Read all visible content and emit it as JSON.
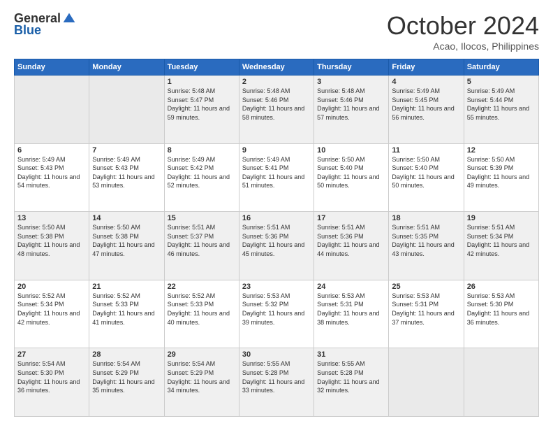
{
  "logo": {
    "general": "General",
    "blue": "Blue"
  },
  "title": "October 2024",
  "location": "Acao, Ilocos, Philippines",
  "days_header": [
    "Sunday",
    "Monday",
    "Tuesday",
    "Wednesday",
    "Thursday",
    "Friday",
    "Saturday"
  ],
  "weeks": [
    [
      {
        "day": "",
        "empty": true
      },
      {
        "day": "",
        "empty": true
      },
      {
        "day": "1",
        "sunrise": "5:48 AM",
        "sunset": "5:47 PM",
        "daylight": "11 hours and 59 minutes."
      },
      {
        "day": "2",
        "sunrise": "5:48 AM",
        "sunset": "5:46 PM",
        "daylight": "11 hours and 58 minutes."
      },
      {
        "day": "3",
        "sunrise": "5:48 AM",
        "sunset": "5:46 PM",
        "daylight": "11 hours and 57 minutes."
      },
      {
        "day": "4",
        "sunrise": "5:49 AM",
        "sunset": "5:45 PM",
        "daylight": "11 hours and 56 minutes."
      },
      {
        "day": "5",
        "sunrise": "5:49 AM",
        "sunset": "5:44 PM",
        "daylight": "11 hours and 55 minutes."
      }
    ],
    [
      {
        "day": "6",
        "sunrise": "5:49 AM",
        "sunset": "5:43 PM",
        "daylight": "11 hours and 54 minutes."
      },
      {
        "day": "7",
        "sunrise": "5:49 AM",
        "sunset": "5:43 PM",
        "daylight": "11 hours and 53 minutes."
      },
      {
        "day": "8",
        "sunrise": "5:49 AM",
        "sunset": "5:42 PM",
        "daylight": "11 hours and 52 minutes."
      },
      {
        "day": "9",
        "sunrise": "5:49 AM",
        "sunset": "5:41 PM",
        "daylight": "11 hours and 51 minutes."
      },
      {
        "day": "10",
        "sunrise": "5:50 AM",
        "sunset": "5:40 PM",
        "daylight": "11 hours and 50 minutes."
      },
      {
        "day": "11",
        "sunrise": "5:50 AM",
        "sunset": "5:40 PM",
        "daylight": "11 hours and 50 minutes."
      },
      {
        "day": "12",
        "sunrise": "5:50 AM",
        "sunset": "5:39 PM",
        "daylight": "11 hours and 49 minutes."
      }
    ],
    [
      {
        "day": "13",
        "sunrise": "5:50 AM",
        "sunset": "5:38 PM",
        "daylight": "11 hours and 48 minutes."
      },
      {
        "day": "14",
        "sunrise": "5:50 AM",
        "sunset": "5:38 PM",
        "daylight": "11 hours and 47 minutes."
      },
      {
        "day": "15",
        "sunrise": "5:51 AM",
        "sunset": "5:37 PM",
        "daylight": "11 hours and 46 minutes."
      },
      {
        "day": "16",
        "sunrise": "5:51 AM",
        "sunset": "5:36 PM",
        "daylight": "11 hours and 45 minutes."
      },
      {
        "day": "17",
        "sunrise": "5:51 AM",
        "sunset": "5:36 PM",
        "daylight": "11 hours and 44 minutes."
      },
      {
        "day": "18",
        "sunrise": "5:51 AM",
        "sunset": "5:35 PM",
        "daylight": "11 hours and 43 minutes."
      },
      {
        "day": "19",
        "sunrise": "5:51 AM",
        "sunset": "5:34 PM",
        "daylight": "11 hours and 42 minutes."
      }
    ],
    [
      {
        "day": "20",
        "sunrise": "5:52 AM",
        "sunset": "5:34 PM",
        "daylight": "11 hours and 42 minutes."
      },
      {
        "day": "21",
        "sunrise": "5:52 AM",
        "sunset": "5:33 PM",
        "daylight": "11 hours and 41 minutes."
      },
      {
        "day": "22",
        "sunrise": "5:52 AM",
        "sunset": "5:33 PM",
        "daylight": "11 hours and 40 minutes."
      },
      {
        "day": "23",
        "sunrise": "5:53 AM",
        "sunset": "5:32 PM",
        "daylight": "11 hours and 39 minutes."
      },
      {
        "day": "24",
        "sunrise": "5:53 AM",
        "sunset": "5:31 PM",
        "daylight": "11 hours and 38 minutes."
      },
      {
        "day": "25",
        "sunrise": "5:53 AM",
        "sunset": "5:31 PM",
        "daylight": "11 hours and 37 minutes."
      },
      {
        "day": "26",
        "sunrise": "5:53 AM",
        "sunset": "5:30 PM",
        "daylight": "11 hours and 36 minutes."
      }
    ],
    [
      {
        "day": "27",
        "sunrise": "5:54 AM",
        "sunset": "5:30 PM",
        "daylight": "11 hours and 36 minutes."
      },
      {
        "day": "28",
        "sunrise": "5:54 AM",
        "sunset": "5:29 PM",
        "daylight": "11 hours and 35 minutes."
      },
      {
        "day": "29",
        "sunrise": "5:54 AM",
        "sunset": "5:29 PM",
        "daylight": "11 hours and 34 minutes."
      },
      {
        "day": "30",
        "sunrise": "5:55 AM",
        "sunset": "5:28 PM",
        "daylight": "11 hours and 33 minutes."
      },
      {
        "day": "31",
        "sunrise": "5:55 AM",
        "sunset": "5:28 PM",
        "daylight": "11 hours and 32 minutes."
      },
      {
        "day": "",
        "empty": true
      },
      {
        "day": "",
        "empty": true
      }
    ]
  ]
}
